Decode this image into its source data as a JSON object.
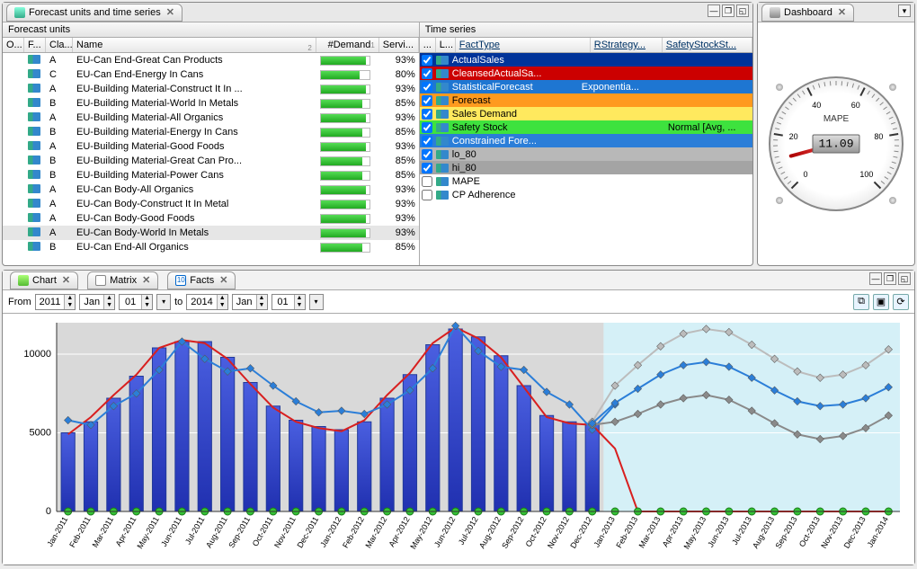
{
  "tabs": {
    "main": "Forecast units and time series",
    "dashboard": "Dashboard",
    "chart": "Chart",
    "matrix": "Matrix",
    "facts": "Facts"
  },
  "forecast_units": {
    "title": "Forecast units",
    "cols": {
      "o": "O...",
      "f": "F...",
      "cla": "Cla...",
      "name": "Name",
      "demand": "#Demand",
      "servi": "Servi..."
    },
    "sort_sub": "2",
    "demand_sub": "1",
    "rows": [
      {
        "cla": "A",
        "name": "EU-Can End-Great Can Products",
        "pct": 93
      },
      {
        "cla": "C",
        "name": "EU-Can End-Energy In Cans",
        "pct": 80
      },
      {
        "cla": "A",
        "name": "EU-Building Material-Construct It In ...",
        "pct": 93
      },
      {
        "cla": "B",
        "name": "EU-Building Material-World In Metals",
        "pct": 85
      },
      {
        "cla": "A",
        "name": "EU-Building Material-All Organics",
        "pct": 93
      },
      {
        "cla": "B",
        "name": "EU-Building Material-Energy In Cans",
        "pct": 85
      },
      {
        "cla": "A",
        "name": "EU-Building Material-Good Foods",
        "pct": 93
      },
      {
        "cla": "B",
        "name": "EU-Building Material-Great Can Pro...",
        "pct": 85
      },
      {
        "cla": "B",
        "name": "EU-Building Material-Power Cans",
        "pct": 85
      },
      {
        "cla": "A",
        "name": "EU-Can Body-All Organics",
        "pct": 93
      },
      {
        "cla": "A",
        "name": "EU-Can Body-Construct It In Metal",
        "pct": 93
      },
      {
        "cla": "A",
        "name": "EU-Can Body-Good Foods",
        "pct": 93
      },
      {
        "cla": "A",
        "name": "EU-Can Body-World In Metals",
        "pct": 93,
        "selected": true
      },
      {
        "cla": "B",
        "name": "EU-Can End-All Organics",
        "pct": 85
      }
    ]
  },
  "time_series": {
    "title": "Time series",
    "cols": {
      "d": "...",
      "l": "L...",
      "fact": "FactType",
      "rstrat": "RStrategy...",
      "ss": "SafetyStockSt..."
    },
    "rows": [
      {
        "chk": true,
        "color": "darkblue",
        "label": "ActualSales",
        "strat": "",
        "ss": ""
      },
      {
        "chk": true,
        "color": "red",
        "label": "CleansedActualSa...",
        "strat": "",
        "ss": ""
      },
      {
        "chk": true,
        "color": "blue",
        "label": "StatisticalForecast",
        "strat": "Exponentia...",
        "ss": ""
      },
      {
        "chk": true,
        "color": "orange",
        "label": "Forecast",
        "strat": "",
        "ss": ""
      },
      {
        "chk": true,
        "color": "yellow",
        "label": "Sales Demand",
        "strat": "",
        "ss": ""
      },
      {
        "chk": true,
        "color": "green",
        "label": "Safety Stock",
        "strat": "",
        "ss": "Normal [Avg, ..."
      },
      {
        "chk": true,
        "color": "midblue",
        "label": "Constrained Fore...",
        "strat": "",
        "ss": ""
      },
      {
        "chk": true,
        "color": "gray",
        "label": "lo_80",
        "strat": "",
        "ss": ""
      },
      {
        "chk": true,
        "color": "gray2",
        "label": "hi_80",
        "strat": "",
        "ss": ""
      },
      {
        "chk": false,
        "color": "none",
        "label": "MAPE",
        "strat": "",
        "ss": ""
      },
      {
        "chk": false,
        "color": "none",
        "label": "CP Adherence",
        "strat": "",
        "ss": ""
      }
    ]
  },
  "dashboard": {
    "label": "MAPE",
    "value": "11.09",
    "ticks": [
      0,
      20,
      40,
      60,
      80,
      100
    ]
  },
  "range": {
    "from_label": "From",
    "to_label": "to",
    "from": {
      "year": "2011",
      "month": "Jan",
      "day": "01"
    },
    "to": {
      "year": "2014",
      "month": "Jan",
      "day": "01"
    }
  },
  "chart_data": {
    "type": "bar+line",
    "ylim": [
      0,
      12000
    ],
    "yticks": [
      0,
      5000,
      10000
    ],
    "forecast_start_index": 24,
    "categories": [
      "Jan-2011",
      "Feb-2011",
      "Mar-2011",
      "Apr-2011",
      "May-2011",
      "Jun-2011",
      "Jul-2011",
      "Aug-2011",
      "Sep-2011",
      "Oct-2011",
      "Nov-2011",
      "Dec-2011",
      "Jan-2012",
      "Feb-2012",
      "Mar-2012",
      "Apr-2012",
      "May-2012",
      "Jun-2012",
      "Jul-2012",
      "Aug-2012",
      "Sep-2012",
      "Oct-2012",
      "Nov-2012",
      "Dec-2012",
      "Jan-2013",
      "Feb-2013",
      "Mar-2013",
      "Apr-2013",
      "May-2013",
      "Jun-2013",
      "Jul-2013",
      "Aug-2013",
      "Sep-2013",
      "Oct-2013",
      "Nov-2013",
      "Dec-2013",
      "Jan-2014"
    ],
    "series": {
      "bars": [
        5000,
        5700,
        7200,
        8600,
        10400,
        10800,
        10800,
        9800,
        8200,
        6700,
        5800,
        5400,
        5200,
        5700,
        7200,
        8700,
        10600,
        11600,
        11100,
        9900,
        8000,
        6100,
        5700,
        5600,
        null,
        null,
        null,
        null,
        null,
        null,
        null,
        null,
        null,
        null,
        null,
        null,
        null
      ],
      "actual_line": [
        5800,
        5500,
        6700,
        7500,
        9000,
        10800,
        9700,
        8900,
        9100,
        8000,
        7000,
        6300,
        6400,
        6200,
        6800,
        7700,
        9100,
        11800,
        10200,
        9200,
        9000,
        7600,
        6800,
        5200,
        6800,
        null,
        null,
        null,
        null,
        null,
        null,
        null,
        null,
        null,
        null,
        null,
        null
      ],
      "red_line": [
        4900,
        6000,
        7400,
        8700,
        10400,
        10900,
        10700,
        9700,
        8100,
        6600,
        5700,
        5300,
        5100,
        5800,
        7400,
        8800,
        10700,
        11700,
        11000,
        9800,
        7900,
        6000,
        5600,
        5500,
        4000,
        0,
        0,
        0,
        0,
        0,
        0,
        0,
        0,
        0,
        0,
        0,
        0
      ],
      "forecast": [
        null,
        null,
        null,
        null,
        null,
        null,
        null,
        null,
        null,
        null,
        null,
        null,
        null,
        null,
        null,
        null,
        null,
        null,
        null,
        null,
        null,
        null,
        null,
        5600,
        6900,
        7800,
        8700,
        9300,
        9500,
        9200,
        8500,
        7700,
        7000,
        6700,
        6800,
        7200,
        7900
      ],
      "hi_80": [
        null,
        null,
        null,
        null,
        null,
        null,
        null,
        null,
        null,
        null,
        null,
        null,
        null,
        null,
        null,
        null,
        null,
        null,
        null,
        null,
        null,
        null,
        null,
        5700,
        8000,
        9300,
        10500,
        11300,
        11600,
        11400,
        10600,
        9700,
        8900,
        8500,
        8700,
        9300,
        10300
      ],
      "lo_80": [
        null,
        null,
        null,
        null,
        null,
        null,
        null,
        null,
        null,
        null,
        null,
        null,
        null,
        null,
        null,
        null,
        null,
        null,
        null,
        null,
        null,
        null,
        null,
        5500,
        5700,
        6200,
        6800,
        7200,
        7400,
        7100,
        6400,
        5600,
        4900,
        4600,
        4800,
        5300,
        6100
      ],
      "green_dots": [
        0,
        0,
        0,
        0,
        0,
        0,
        0,
        0,
        0,
        0,
        0,
        0,
        0,
        0,
        0,
        0,
        0,
        0,
        0,
        0,
        0,
        0,
        0,
        0,
        0,
        0,
        0,
        0,
        0,
        0,
        0,
        0,
        0,
        0,
        0,
        0,
        0
      ]
    }
  }
}
